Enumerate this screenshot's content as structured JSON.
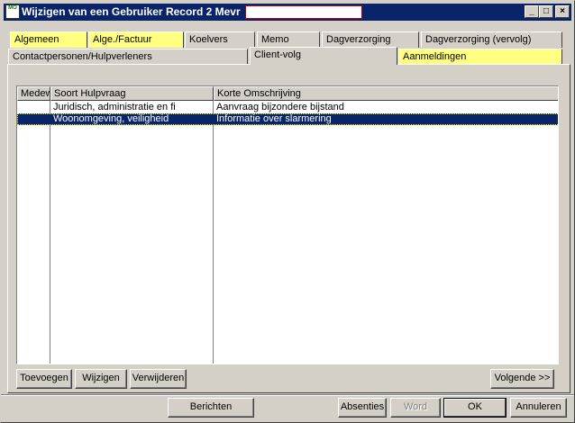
{
  "window": {
    "title": "Wijzigen van een Gebruiker Record 2 Mevr",
    "app_icon_text": "MO",
    "controls": {
      "minimize": "_",
      "maximize": "□",
      "close": "×"
    }
  },
  "tabs_row1": [
    {
      "label": "Algemeen",
      "highlight": true
    },
    {
      "label": "Alge./Factuur",
      "highlight": true
    },
    {
      "label": "Koelvers",
      "highlight": false
    },
    {
      "label": "Memo",
      "highlight": false
    },
    {
      "label": "Dagverzorging",
      "highlight": false
    },
    {
      "label": "Dagverzorging (vervolg)",
      "highlight": false
    }
  ],
  "tabs_row2": [
    {
      "label": "Contactpersonen/Hulpverleners",
      "highlight": false
    },
    {
      "label": "Client-volg",
      "highlight": false,
      "active": true
    },
    {
      "label": "Aanmeldingen",
      "highlight": true
    }
  ],
  "grid": {
    "columns": [
      "Medew",
      "Soort Hulpvraag",
      "Korte Omschrijving"
    ],
    "rows": [
      {
        "medew": "",
        "soort": "Juridisch, administratie en fi",
        "omschrijving": "Aanvraag bijzondere bijstand",
        "selected": false
      },
      {
        "medew": "",
        "soort": "Woonomgeving, veiligheid",
        "omschrijving": "Informatie over slarmering",
        "selected": true
      }
    ]
  },
  "panel_buttons": {
    "add": "Toevoegen",
    "edit": "Wijzigen",
    "delete": "Verwijderen",
    "next": "Volgende >>"
  },
  "footer_buttons": {
    "messages": "Berichten",
    "absences": "Absenties",
    "word": "Word",
    "ok": "OK",
    "cancel": "Annuleren"
  },
  "colors": {
    "titlebar": "#0a246a",
    "highlight_tab": "#ffff80",
    "selection": "#0a246a",
    "title_field_border": "#c00000"
  }
}
